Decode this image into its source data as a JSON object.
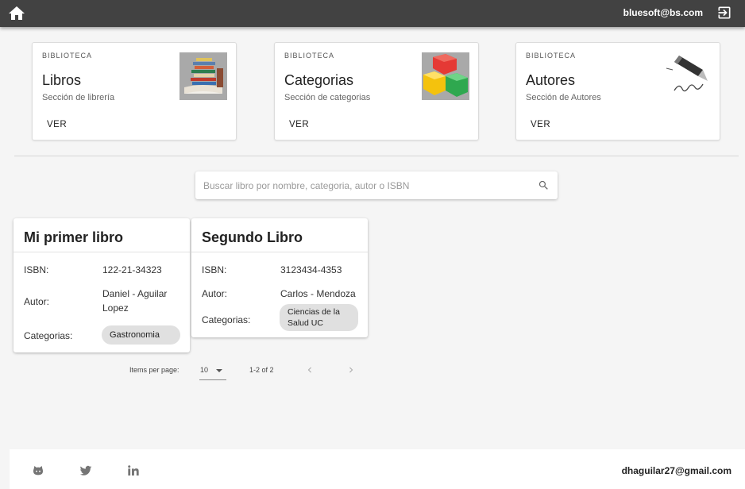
{
  "header": {
    "user_email": "bluesoft@bs.com",
    "home_icon": "home-icon",
    "logout_icon": "logout-icon",
    "bar_color": "#424242"
  },
  "categories": [
    {
      "overline": "BIBLIOTECA",
      "title": "Libros",
      "subtitle": "Sección de librería",
      "action": "VER",
      "image": "books-stack-image"
    },
    {
      "overline": "BIBLIOTECA",
      "title": "Categorias",
      "subtitle": "Sección de categorias",
      "action": "VER",
      "image": "colored-boxes-image"
    },
    {
      "overline": "BIBLIOTECA",
      "title": "Autores",
      "subtitle": "Sección de Autores",
      "action": "VER",
      "image": "fountain-pen-image"
    }
  ],
  "search": {
    "placeholder": "Buscar libro por nombre, categoria, autor o ISBN",
    "value": "",
    "icon": "search-icon"
  },
  "books": [
    {
      "title": "Mi primer libro",
      "isbn_label": "ISBN:",
      "isbn": "122-21-34323",
      "author_label": "Autor:",
      "author": "Daniel - Aguilar Lopez",
      "categories_label": "Categorias:",
      "category": "Gastronomia"
    },
    {
      "title": "Segundo Libro",
      "isbn_label": "ISBN:",
      "isbn": "3123434-4353",
      "author_label": "Autor:",
      "author": "Carlos - Mendoza",
      "categories_label": "Categorias:",
      "category": "Ciencias de la Salud UC"
    }
  ],
  "paginator": {
    "items_per_page_label": "Items per page:",
    "page_size": "10",
    "range_label": "1-2 of 2"
  },
  "footer": {
    "email": "dhaguilar27@gmail.com",
    "icons": [
      "github-icon",
      "twitter-icon",
      "linkedin-icon"
    ]
  }
}
